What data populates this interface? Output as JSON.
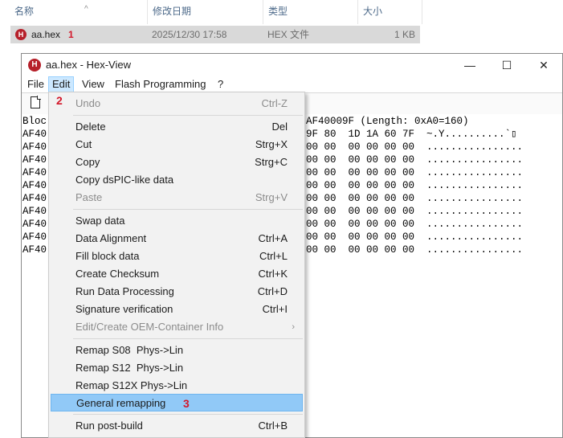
{
  "explorer": {
    "columns": [
      "名称",
      "修改日期",
      "类型",
      "大小"
    ],
    "file": {
      "name": "aa.hex",
      "modified": "2025/12/30 17:58",
      "type": "HEX 文件",
      "size": "1 KB"
    },
    "markers": [
      "1",
      "2",
      "3"
    ]
  },
  "window": {
    "title": "aa.hex - Hex-View",
    "icon_letter": "H",
    "controls": [
      "—",
      "☐",
      "✕"
    ],
    "menu": [
      "File",
      "Edit",
      "View",
      "Flash Programming",
      "?"
    ],
    "content_lines": [
      "Bloc",
      "AF40",
      "AF40",
      "AF40",
      "AF40",
      "AF40",
      "AF40",
      "AF40",
      "AF40",
      "AF40",
      "AF40"
    ],
    "content_right": [
      "AF40009F (Length: 0xA0=160)",
      "9F 80  1D 1A 60 7F  ~.Y..........`▯",
      "00 00  00 00 00 00  ................",
      "00 00  00 00 00 00  ................",
      "00 00  00 00 00 00  ................",
      "00 00  00 00 00 00  ................",
      "00 00  00 00 00 00  ................",
      "00 00  00 00 00 00  ................",
      "00 00  00 00 00 00  ................",
      "00 00  00 00 00 00  ................",
      "00 00  00 00 00 00  ................"
    ]
  },
  "edit_menu": {
    "items": [
      {
        "label": "Undo",
        "shortcut": "Ctrl-Z"
      },
      {
        "label": "Delete",
        "shortcut": "Del"
      },
      {
        "label": "Cut",
        "shortcut": "Strg+X"
      },
      {
        "label": "Copy",
        "shortcut": "Strg+C"
      },
      {
        "label": "Copy dsPIC-like data",
        "shortcut": ""
      },
      {
        "label": "Paste",
        "shortcut": "Strg+V"
      },
      {
        "label": "Swap data",
        "shortcut": ""
      },
      {
        "label": "Data Alignment",
        "shortcut": "Ctrl+A"
      },
      {
        "label": "Fill block data",
        "shortcut": "Ctrl+L"
      },
      {
        "label": "Create Checksum",
        "shortcut": "Ctrl+K"
      },
      {
        "label": "Run Data Processing",
        "shortcut": "Ctrl+D"
      },
      {
        "label": "Signature verification",
        "shortcut": "Ctrl+I"
      },
      {
        "label": "Edit/Create OEM-Container Info",
        "shortcut": ""
      },
      {
        "label": "Remap S08  Phys->Lin",
        "shortcut": ""
      },
      {
        "label": "Remap S12  Phys->Lin",
        "shortcut": ""
      },
      {
        "label": "Remap S12X Phys->Lin",
        "shortcut": ""
      },
      {
        "label": "General remapping",
        "shortcut": ""
      },
      {
        "label": "Run post-build",
        "shortcut": "Ctrl+B"
      }
    ],
    "submenu_arrow": "›"
  },
  "colors": {
    "highlight": "#91c9f7",
    "menu_active": "#cce8ff",
    "marker": "#d3172a",
    "icon": "#b6202a"
  }
}
